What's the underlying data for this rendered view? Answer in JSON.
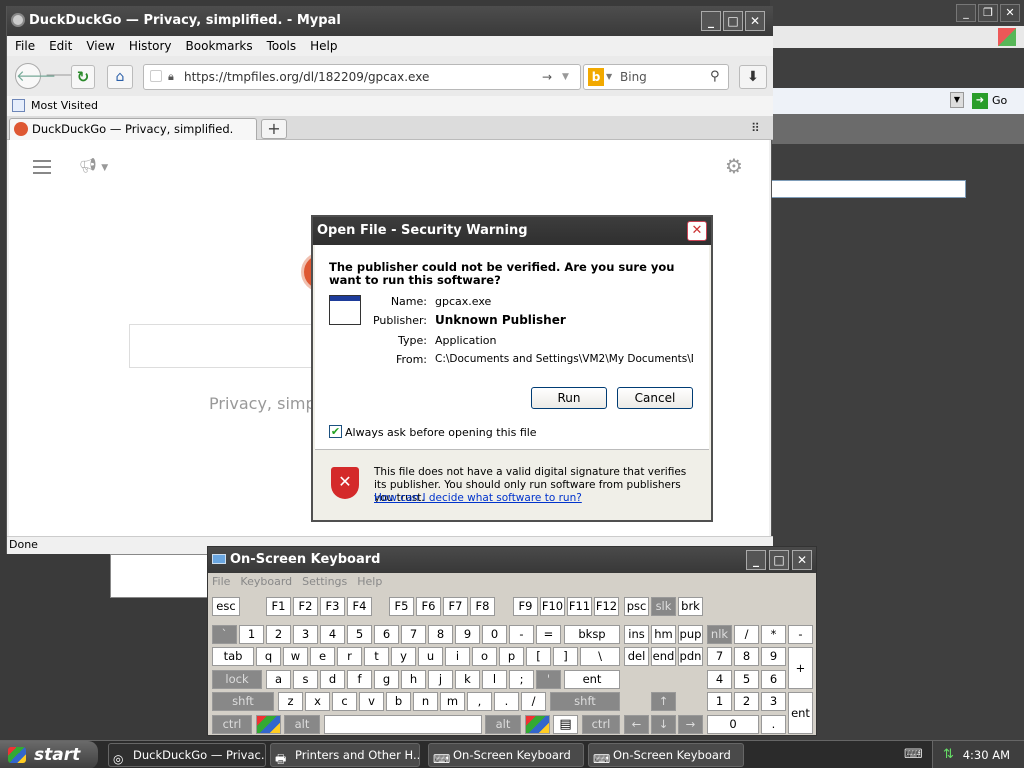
{
  "browser": {
    "title": "DuckDuckGo — Privacy, simplified. - Mypal",
    "menu": [
      "File",
      "Edit",
      "View",
      "History",
      "Bookmarks",
      "Tools",
      "Help"
    ],
    "url": "https://tmpfiles.org/dl/182209/gpcax.exe",
    "search_engine": "Bing",
    "bookmark": "Most Visited",
    "tab_label": "DuckDuckGo — Privacy, simplified.",
    "status": "Done",
    "page_tagline": "Privacy, simp"
  },
  "background_window": {
    "go_label": "Go"
  },
  "dialog": {
    "title": "Open File - Security Warning",
    "question": "The publisher could not be verified.  Are you sure you want to run this software?",
    "fields": [
      {
        "label": "Name:",
        "value": "gpcax.exe"
      },
      {
        "label": "Publisher:",
        "value": "Unknown Publisher"
      },
      {
        "label": "Type:",
        "value": "Application"
      },
      {
        "label": "From:",
        "value": "C:\\Documents and Settings\\VM2\\My Documents\\D..."
      }
    ],
    "run_label": "Run",
    "cancel_label": "Cancel",
    "checkbox_label": "Always ask before opening this file",
    "warning_text": "This file does not have a valid digital signature that verifies its publisher.  You should only run software from publishers you trust.",
    "help_link": "How can I decide what software to run?"
  },
  "osk": {
    "title": "On-Screen Keyboard",
    "menu": [
      "File",
      "Keyboard",
      "Settings",
      "Help"
    ],
    "rows": [
      [
        "esc",
        "F1",
        "F2",
        "F3",
        "F4",
        "F5",
        "F6",
        "F7",
        "F8",
        "F9",
        "F10",
        "F11",
        "F12",
        "psc",
        "slk",
        "brk"
      ],
      [
        "`",
        "1",
        "2",
        "3",
        "4",
        "5",
        "6",
        "7",
        "8",
        "9",
        "0",
        "-",
        "=",
        "bksp",
        "ins",
        "hm",
        "pup",
        "nlk",
        "/",
        "*",
        "-"
      ],
      [
        "tab",
        "q",
        "w",
        "e",
        "r",
        "t",
        "y",
        "u",
        "i",
        "o",
        "p",
        "[",
        "]",
        "\\",
        "del",
        "end",
        "pdn",
        "7",
        "8",
        "9",
        "+"
      ],
      [
        "lock",
        "a",
        "s",
        "d",
        "f",
        "g",
        "h",
        "j",
        "k",
        "l",
        ";",
        "'",
        "ent",
        "4",
        "5",
        "6"
      ],
      [
        "shft",
        "z",
        "x",
        "c",
        "v",
        "b",
        "n",
        "m",
        ",",
        ".",
        "/",
        "shft",
        "1",
        "2",
        "3",
        "ent"
      ],
      [
        "ctrl",
        "alt",
        "alt",
        "ctrl",
        "0",
        "."
      ]
    ]
  },
  "taskbar": {
    "start_label": "start",
    "tasks": [
      "DuckDuckGo — Privac...",
      "Printers and Other H...",
      "On-Screen Keyboard",
      "On-Screen Keyboard"
    ],
    "clock": "4:30 AM"
  }
}
